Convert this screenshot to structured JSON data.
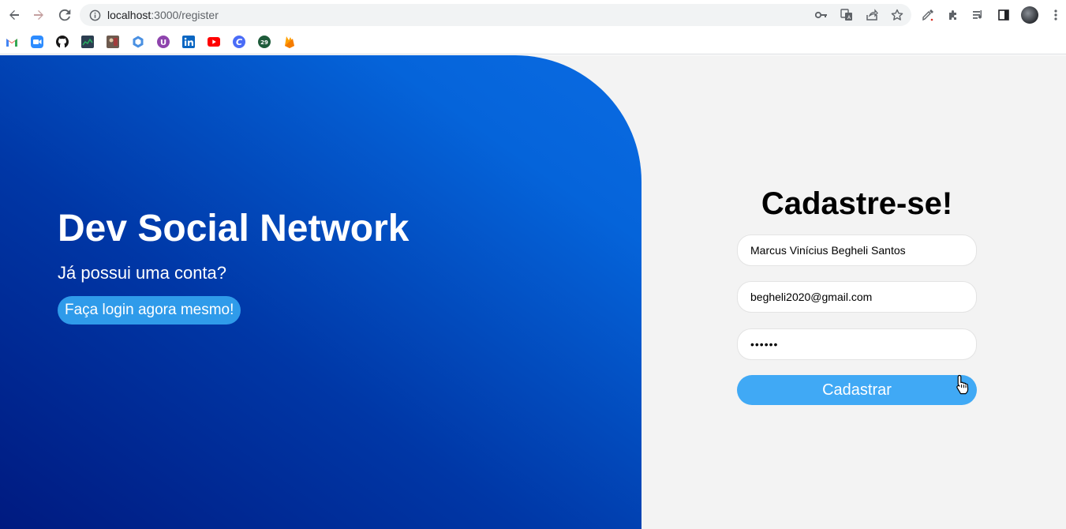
{
  "browser": {
    "url_host": "localhost",
    "url_path": ":3000/register",
    "bookmarks": [
      "gmail-icon",
      "zoom-icon",
      "github-icon",
      "chart-icon",
      "photo-icon",
      "hexagon-icon",
      "u-icon",
      "linkedin-icon",
      "youtube-icon",
      "c-icon",
      "badge-29-icon",
      "firebase-icon"
    ],
    "badge_29": "29"
  },
  "hero": {
    "title": "Dev Social Network",
    "subtitle": "Já possui uma conta?",
    "login_link": "Faça login agora mesmo!"
  },
  "form": {
    "title": "Cadastre-se!",
    "name_value": "Marcus Vinícius Begheli Santos",
    "email_value": "begheli2020@gmail.com",
    "password_value": "••••••",
    "submit_label": "Cadastrar"
  },
  "colors": {
    "hero_gradient_start": "#001a80",
    "hero_gradient_end": "#0a6be2",
    "login_button": "#2f9bea",
    "submit_button": "#40a9f5",
    "page_background": "#f3f3f3"
  }
}
